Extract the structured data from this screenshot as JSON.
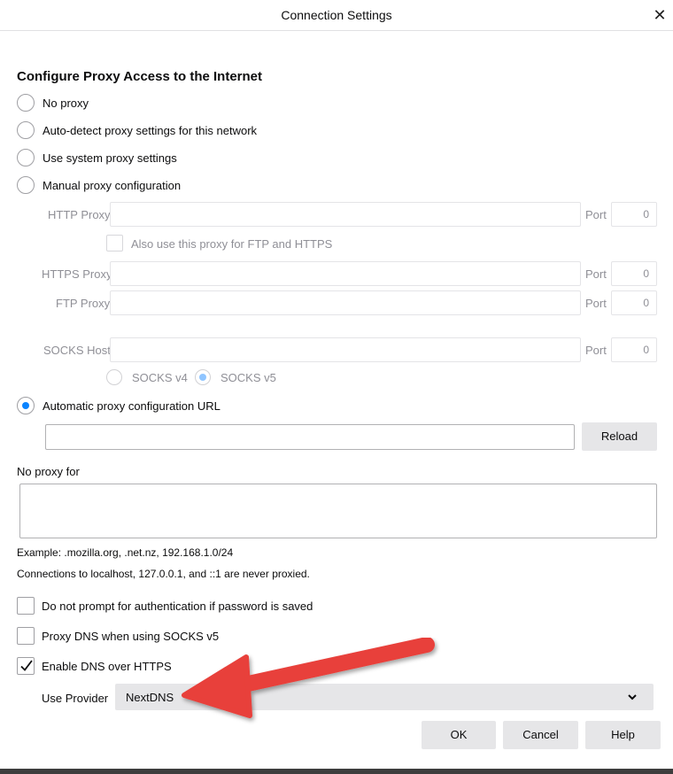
{
  "window": {
    "title": "Connection Settings",
    "close_symbol": "✕"
  },
  "proxy": {
    "heading": "Configure Proxy Access to the Internet",
    "options": {
      "no_proxy": "No proxy",
      "auto_detect": "Auto-detect proxy settings for this network",
      "system": "Use system proxy settings",
      "manual": "Manual proxy configuration",
      "auto_url": "Automatic proxy configuration URL"
    },
    "selected": "auto_url",
    "manual": {
      "http_label": "HTTP Proxy",
      "http_value": "",
      "http_port_label": "Port",
      "http_port_value": "0",
      "also_use_label": "Also use this proxy for FTP and HTTPS",
      "https_label": "HTTPS Proxy",
      "https_value": "",
      "https_port_label": "Port",
      "https_port_value": "0",
      "ftp_label": "FTP Proxy",
      "ftp_value": "",
      "ftp_port_label": "Port",
      "ftp_port_value": "0",
      "socks_label": "SOCKS Host",
      "socks_value": "",
      "socks_port_label": "Port",
      "socks_port_value": "0",
      "socks_v4_label": "SOCKS v4",
      "socks_v5_label": "SOCKS v5",
      "socks_selected": "v5"
    },
    "auto_url_value": "",
    "reload_label": "Reload"
  },
  "no_proxy_for": {
    "label": "No proxy for",
    "value": "",
    "example": "Example: .mozilla.org, .net.nz, 192.168.1.0/24",
    "note": "Connections to localhost, 127.0.0.1, and ::1 are never proxied."
  },
  "options": {
    "no_prompt_auth": {
      "label": "Do not prompt for authentication if password is saved",
      "checked": false
    },
    "proxy_dns": {
      "label": "Proxy DNS when using SOCKS v5",
      "checked": false
    },
    "dns_https": {
      "label": "Enable DNS over HTTPS",
      "checked": true
    }
  },
  "provider": {
    "label": "Use Provider",
    "value": "NextDNS"
  },
  "buttons": {
    "ok": "OK",
    "cancel": "Cancel",
    "help": "Help"
  },
  "colors": {
    "accent": "#0a84ff",
    "annotation_arrow": "#e8413a",
    "button_bg": "#e6e6e8"
  },
  "icons": {
    "checkmark": "✓",
    "dropdown": "chevron-down-icon",
    "arrow": "annotation-arrow"
  }
}
